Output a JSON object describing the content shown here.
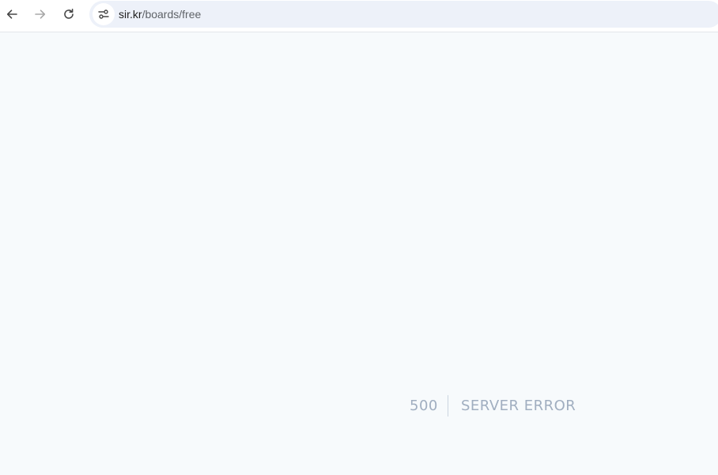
{
  "browser": {
    "url_host": "sir.kr",
    "url_path": "/boards/free",
    "icons": {
      "back": "arrow-left-icon",
      "forward": "arrow-right-icon",
      "reload": "reload-icon",
      "site_info": "tune-icon"
    }
  },
  "page": {
    "error_code": "500",
    "error_message": "SERVER ERROR",
    "colors": {
      "background": "#f7fafc",
      "error_text": "#a0aec0",
      "divider": "#cbd5e0"
    }
  }
}
